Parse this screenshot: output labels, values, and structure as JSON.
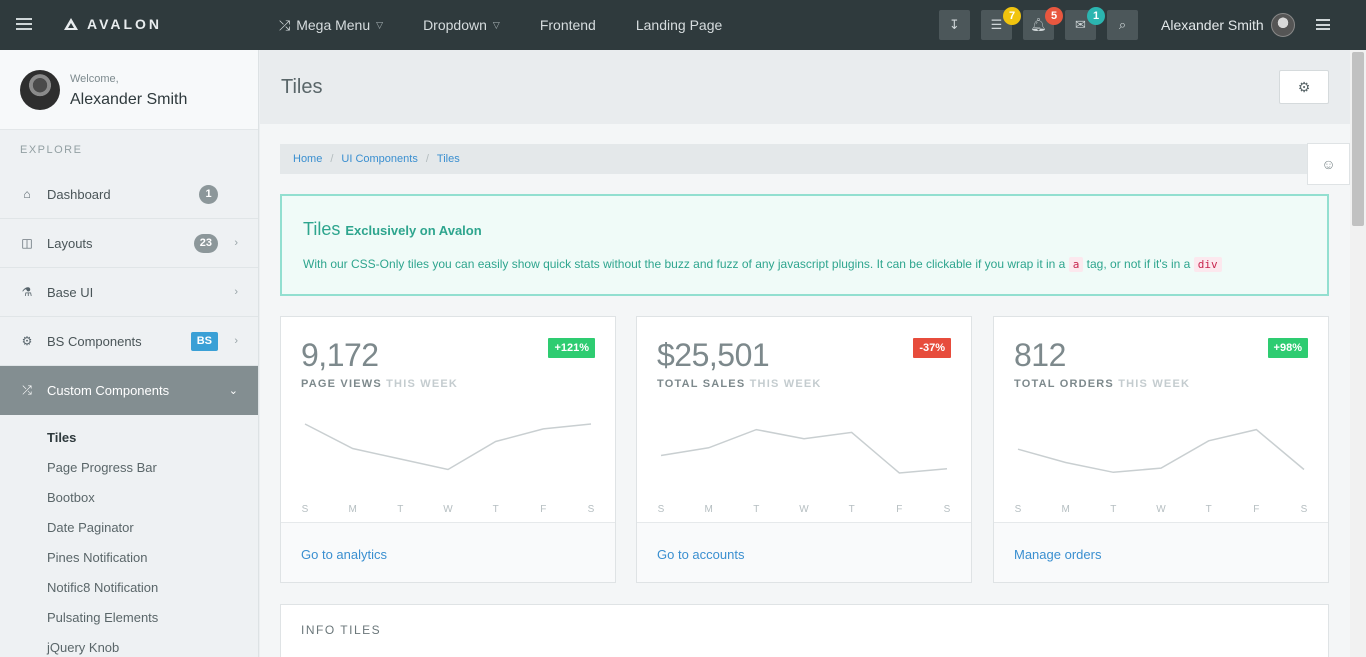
{
  "topbar": {
    "brand": "AVALON",
    "nav": [
      {
        "label": "Mega Menu",
        "dropdown": true,
        "icon": "shuffle-icon"
      },
      {
        "label": "Dropdown",
        "dropdown": true
      },
      {
        "label": "Frontend",
        "dropdown": false
      },
      {
        "label": "Landing Page",
        "dropdown": false
      }
    ],
    "badges": {
      "tasks": "7",
      "notifications": "5",
      "messages": "1"
    },
    "badge_colors": {
      "tasks": "#f1c40f",
      "notifications": "#e8573f",
      "messages": "#2bb5b0"
    },
    "user_name": "Alexander Smith"
  },
  "sidebar": {
    "welcome": "Welcome,",
    "user_name": "Alexander Smith",
    "section": "EXPLORE",
    "items": [
      {
        "label": "Dashboard",
        "icon": "home-icon",
        "count": "1"
      },
      {
        "label": "Layouts",
        "icon": "columns-icon",
        "count": "23"
      },
      {
        "label": "Base UI",
        "icon": "flask-icon"
      },
      {
        "label": "BS Components",
        "icon": "cogs-icon",
        "count": "BS"
      },
      {
        "label": "Custom Components",
        "icon": "shuffle-icon"
      }
    ],
    "subitems": [
      "Tiles",
      "Page Progress Bar",
      "Bootbox",
      "Date Paginator",
      "Pines Notification",
      "Notific8 Notification",
      "Pulsating Elements",
      "jQuery Knob"
    ]
  },
  "page": {
    "title": "Tiles",
    "breadcrumb": [
      "Home",
      "UI Components",
      "Tiles"
    ]
  },
  "alert": {
    "title": "Tiles",
    "title_suffix": "Exclusively on Avalon",
    "text_1": "With our CSS-Only tiles you can easily show quick stats without the buzz and fuzz of any javascript plugins. It can be clickable if you wrap it in a",
    "code_1": "a",
    "text_2": "tag, or not if it's in a",
    "code_2": "div"
  },
  "tiles": [
    {
      "value": "9,172",
      "label": "PAGE VIEWS",
      "period": "THIS WEEK",
      "change": "+121%",
      "change_color": "#2ecc71",
      "link": "Go to analytics"
    },
    {
      "value": "$25,501",
      "label": "TOTAL SALES",
      "period": "THIS WEEK",
      "change": "-37%",
      "change_color": "#e74c3c",
      "link": "Go to accounts"
    },
    {
      "value": "812",
      "label": "TOTAL ORDERS",
      "period": "THIS WEEK",
      "change": "+98%",
      "change_color": "#2ecc71",
      "link": "Manage orders"
    }
  ],
  "info_tiles": {
    "title": "INFO TILES"
  },
  "chart_data": [
    {
      "type": "line",
      "categories": [
        "S",
        "M",
        "T",
        "W",
        "T",
        "F",
        "S"
      ],
      "values": [
        9,
        5.5,
        4,
        2.5,
        6.5,
        8.3,
        9
      ]
    },
    {
      "type": "line",
      "categories": [
        "S",
        "M",
        "T",
        "W",
        "T",
        "F",
        "S"
      ],
      "values": [
        4.5,
        5.6,
        8.2,
        6.9,
        7.8,
        2,
        2.6
      ]
    },
    {
      "type": "line",
      "categories": [
        "S",
        "M",
        "T",
        "W",
        "T",
        "F",
        "S"
      ],
      "values": [
        5.4,
        3.5,
        2.1,
        2.7,
        6.6,
        8.2,
        2.5
      ]
    }
  ]
}
